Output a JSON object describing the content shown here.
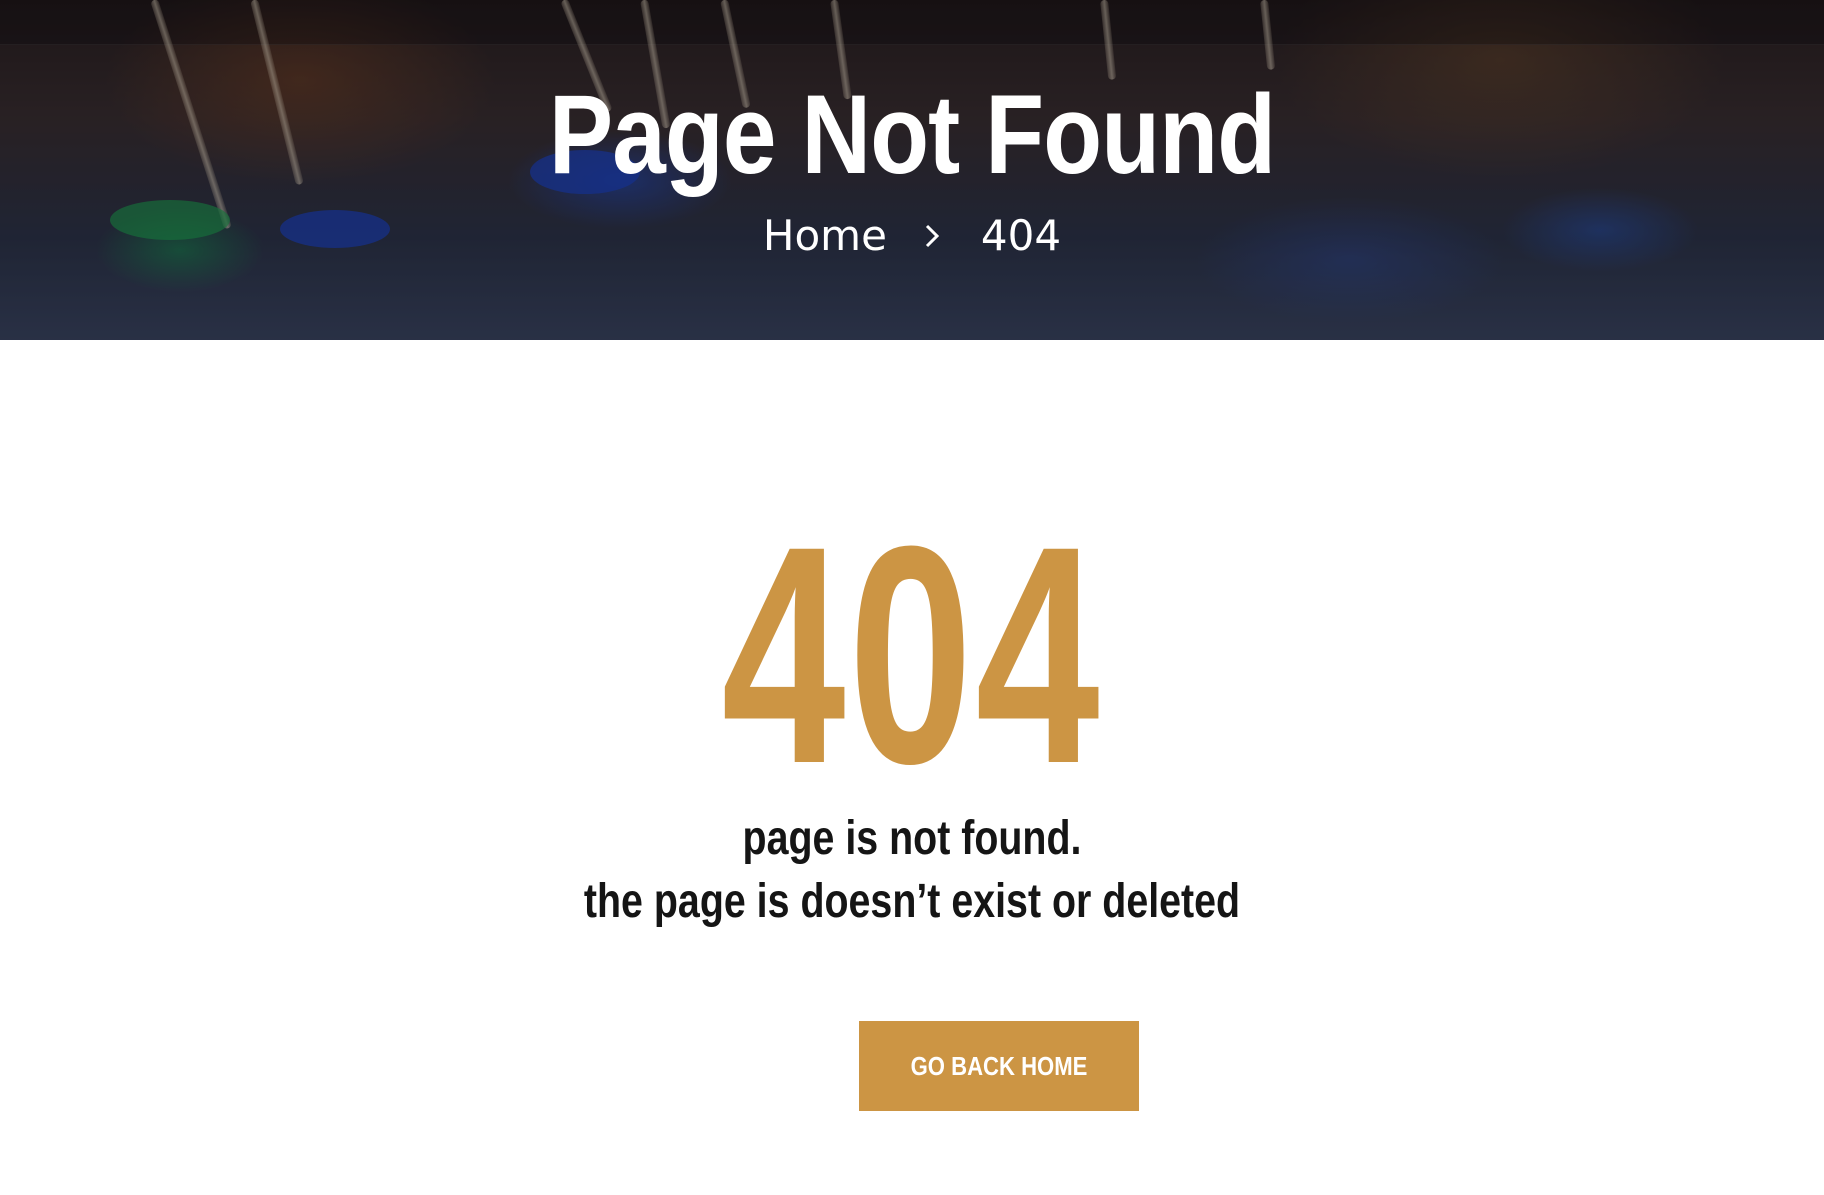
{
  "hero": {
    "title": "Page Not Found",
    "breadcrumb": {
      "home_label": "Home",
      "separator_icon": "chevron-right-icon",
      "current_label": "404"
    }
  },
  "main": {
    "error_code": "404",
    "message_line_1": "page is not found.",
    "message_line_2": "the page is doesn’t exist or deleted",
    "button_label": "GO BACK HOME"
  },
  "colors": {
    "accent": "#cc9544",
    "text_dark": "#151515",
    "hero_text": "#ffffff"
  }
}
